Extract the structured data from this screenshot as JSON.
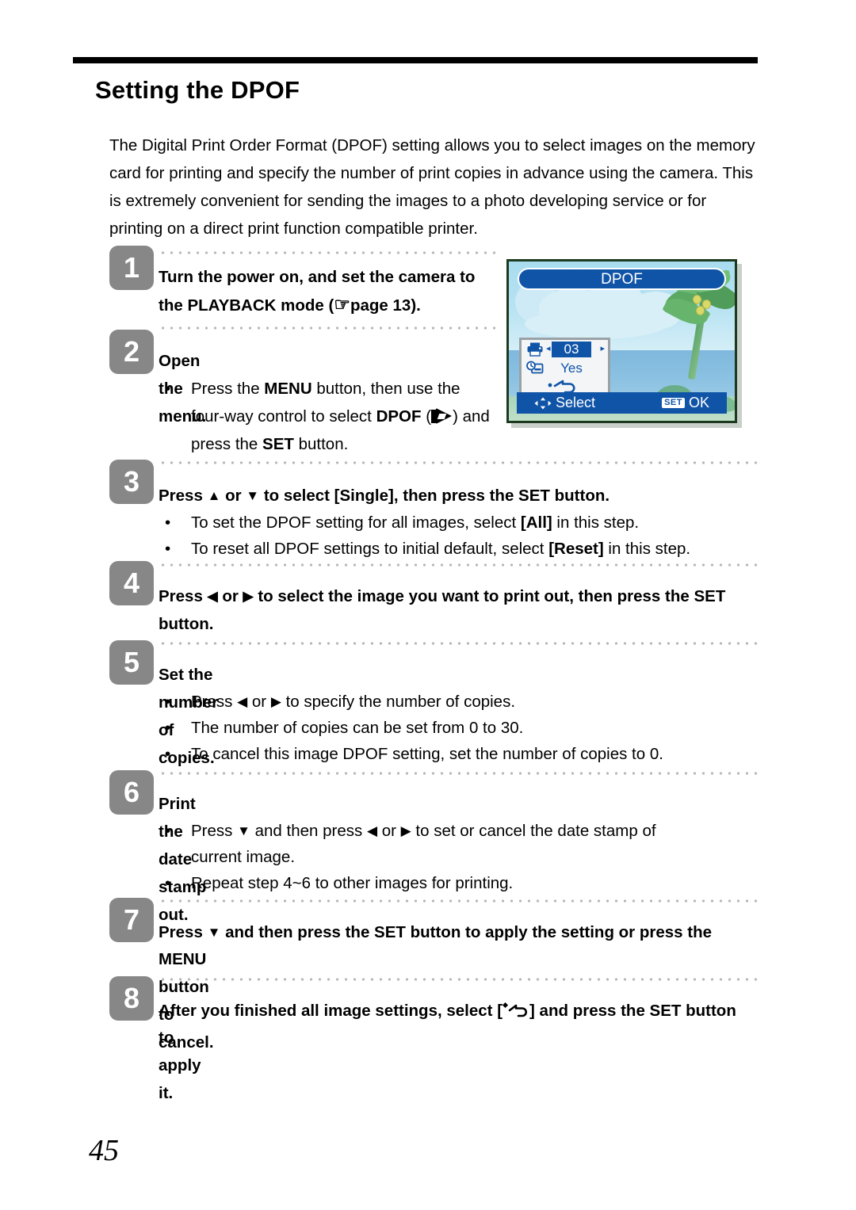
{
  "page": {
    "title": "Setting the DPOF",
    "number": "45",
    "intro": "The Digital Print Order Format (DPOF) setting allows you to select images on the memory card for printing and specify the number of print copies in advance using the camera. This is extremely convenient for sending the images to a photo developing service or for printing on a direct print function compatible printer."
  },
  "steps": [
    {
      "num": "1",
      "text_a": "Turn the power on, and set the camera to",
      "text_b_pre": "the PLAYBACK mode (",
      "text_b_post": "page 13).",
      "hand_icon": "pointing-hand-icon"
    },
    {
      "num": "2",
      "heading": "Open the menu.",
      "bullets": [
        {
          "pre": "Press the ",
          "bold1": "MENU",
          "mid": " button, then use the four-way control to select ",
          "bold2": "DPOF",
          "pre_icon": " (",
          "post_icon": ") and press the ",
          "bold3": "SET",
          "tail": " button."
        }
      ]
    },
    {
      "num": "3",
      "head_pre": "Press ",
      "head_up": "▲",
      "head_mid": " or ",
      "head_down": "▼",
      "head_post": " to select [Single], then press the SET button.",
      "bullets": [
        {
          "pre": "To set the DPOF setting for all images, select ",
          "bold": "[All]",
          "post": " in this step."
        },
        {
          "pre": "To reset all DPOF settings to initial default, select ",
          "bold": "[Reset]",
          "post": " in this step."
        }
      ]
    },
    {
      "num": "4",
      "head_pre": "Press ",
      "head_left": "◀",
      "head_mid": " or ",
      "head_right": "▶",
      "head_post": " to select the image you want to print out, then press the SET",
      "head_line2": "button."
    },
    {
      "num": "5",
      "heading": "Set the number of copies.",
      "bullets": [
        {
          "pre": "Press ",
          "left": "◀",
          "mid": " or ",
          "right": "▶",
          "post": " to specify the number of copies."
        },
        {
          "text": "The number of copies can be set from 0 to 30."
        },
        {
          "text": "To cancel this image DPOF setting, set the number of copies to 0."
        }
      ]
    },
    {
      "num": "6",
      "heading": "Print the date stamp out.",
      "bullets": [
        {
          "pre": "Press ",
          "down": "▼",
          "mid": " and then press ",
          "left": "◀",
          "mid2": " or ",
          "right": "▶",
          "post": " to set or cancel the date stamp of",
          "line2": "current image."
        },
        {
          "text": "Repeat step 4~6 to other images for printing."
        }
      ]
    },
    {
      "num": "7",
      "head_pre": "Press ",
      "head_down": "▼",
      "head_post": " and then press the SET button to apply the setting or press the",
      "head_line2": "MENU button to cancel."
    },
    {
      "num": "8",
      "head_pre": "After you finished all image settings, select [",
      "head_post": "] and press the SET button",
      "head_line2": "to apply it.",
      "return_icon": "return-arrow-icon"
    }
  ],
  "lcd": {
    "title": "DPOF",
    "menu": {
      "copies_icon": "printer-icon",
      "copies_value": "03",
      "copies_left_arrow": "◂",
      "copies_right_arrow": "▸",
      "datestamp_icon": "date-stamp-icon",
      "datestamp_value": "Yes",
      "exit_icon": "return-arrow-icon"
    },
    "statusbar": {
      "nav_icon": "four-way-nav-icon",
      "select_label": "Select",
      "set_badge": "SET",
      "ok_label": "OK"
    }
  },
  "colors": {
    "badge_gray": "#878787",
    "lcd_blue": "#1054a8",
    "sky": "#b9e3f2",
    "sea": "#8cc2e2",
    "rule_black": "#000000"
  }
}
